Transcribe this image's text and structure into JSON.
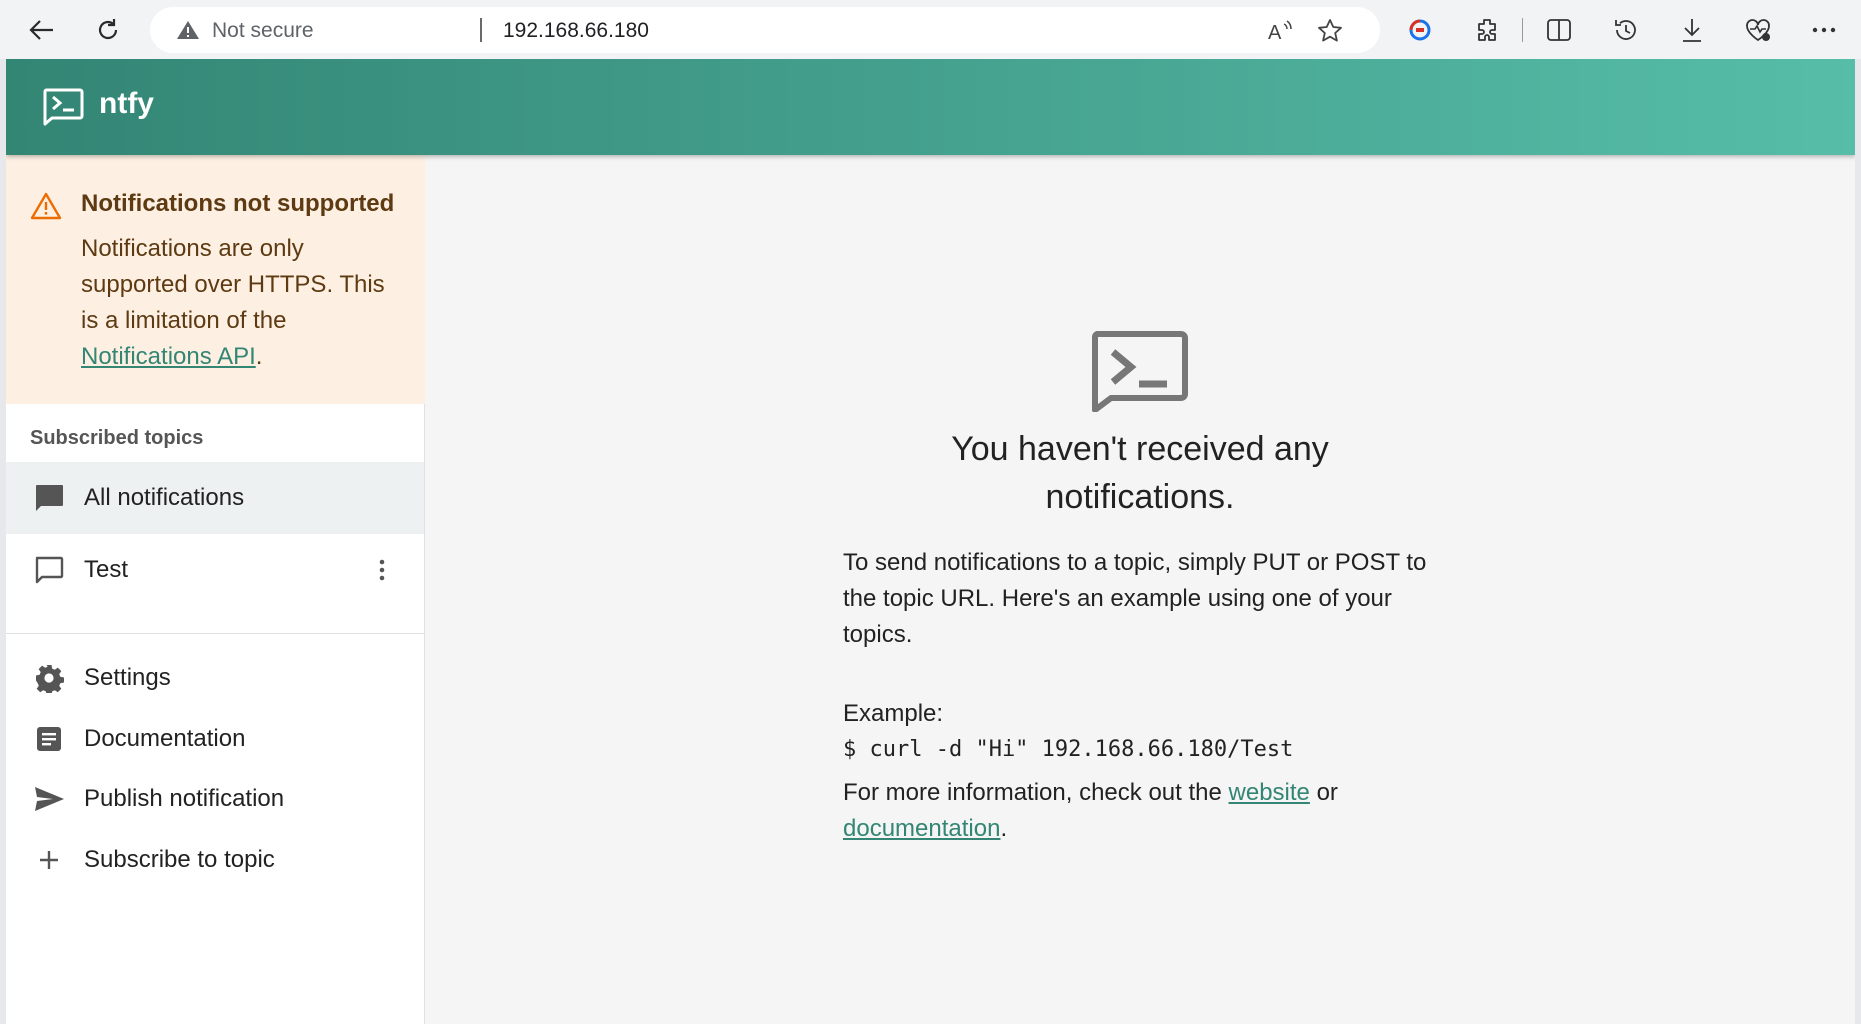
{
  "browser": {
    "security_label": "Not secure",
    "url": "192.168.66.180"
  },
  "app": {
    "title": "ntfy"
  },
  "alert": {
    "title": "Notifications not supported",
    "body_text": "Notifications are only supported over HTTPS. This is a limitation of the",
    "link_text": "Notifications API",
    "trailing": "."
  },
  "sidebar": {
    "section_label": "Subscribed topics",
    "topics": [
      {
        "label": "All notifications",
        "icon": "chat-filled-icon",
        "selected": true
      },
      {
        "label": "Test",
        "icon": "chat-outline-icon",
        "selected": false
      }
    ],
    "actions": [
      {
        "label": "Settings",
        "icon": "gear-icon"
      },
      {
        "label": "Documentation",
        "icon": "document-icon"
      },
      {
        "label": "Publish notification",
        "icon": "send-icon"
      },
      {
        "label": "Subscribe to topic",
        "icon": "plus-icon"
      }
    ]
  },
  "main": {
    "empty_title": "You haven't received any notifications.",
    "intro": "To send notifications to a topic, simply PUT or POST to the topic URL. Here's an example using one of your topics.",
    "example_label": "Example:",
    "example_code": "$ curl -d \"Hi\" 192.168.66.180/Test",
    "more_info_prefix": "For more information, check out the",
    "website_link": "website",
    "or_text": "or",
    "documentation_link": "documentation",
    "more_info_suffix": "."
  },
  "colors": {
    "header_start": "#338574",
    "header_end": "#56bda8",
    "link": "#338574",
    "alert_bg": "#fdf0e3"
  }
}
